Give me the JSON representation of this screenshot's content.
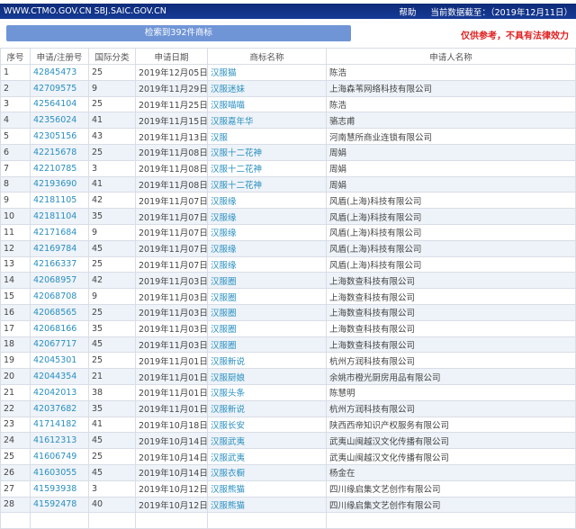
{
  "header": {
    "domains": "WWW.CTMO.GOV.CN SBJ.SAIC.GOV.CN",
    "help": "帮助",
    "data_date": "当前数据截至：（2019年12月11日）"
  },
  "search_result_label": "检索到392件商标",
  "disclaimer": "仅供参考，不具有法律效力",
  "columns": [
    "序号",
    "申请/注册号",
    "国际分类",
    "申请日期",
    "商标名称",
    "申请人名称"
  ],
  "rows": [
    [
      "1",
      "42845473",
      "25",
      "2019年12月05日",
      "汉服猫",
      "陈浩"
    ],
    [
      "2",
      "42709575",
      "9",
      "2019年11月29日",
      "汉服迷妹",
      "上海森苇网络科技有限公司"
    ],
    [
      "3",
      "42564104",
      "25",
      "2019年11月25日",
      "汉服喵喵",
      "陈浩"
    ],
    [
      "4",
      "42356024",
      "41",
      "2019年11月15日",
      "汉服嘉年华",
      "骆志甫"
    ],
    [
      "5",
      "42305156",
      "43",
      "2019年11月13日",
      "汉服",
      "河南慧所商业连锁有限公司"
    ],
    [
      "6",
      "42215678",
      "25",
      "2019年11月08日",
      "汉服十二花神",
      "周娟"
    ],
    [
      "7",
      "42210785",
      "3",
      "2019年11月08日",
      "汉服十二花神",
      "周娟"
    ],
    [
      "8",
      "42193690",
      "41",
      "2019年11月08日",
      "汉服十二花神",
      "周娟"
    ],
    [
      "9",
      "42181105",
      "42",
      "2019年11月07日",
      "汉服缘",
      "风盾(上海)科技有限公司"
    ],
    [
      "10",
      "42181104",
      "35",
      "2019年11月07日",
      "汉服缘",
      "风盾(上海)科技有限公司"
    ],
    [
      "11",
      "42171684",
      "9",
      "2019年11月07日",
      "汉服缘",
      "风盾(上海)科技有限公司"
    ],
    [
      "12",
      "42169784",
      "45",
      "2019年11月07日",
      "汉服缘",
      "风盾(上海)科技有限公司"
    ],
    [
      "13",
      "42166337",
      "25",
      "2019年11月07日",
      "汉服缘",
      "风盾(上海)科技有限公司"
    ],
    [
      "14",
      "42068957",
      "42",
      "2019年11月03日",
      "汉服圈",
      "上海数查科技有限公司"
    ],
    [
      "15",
      "42068708",
      "9",
      "2019年11月03日",
      "汉服圈",
      "上海数查科技有限公司"
    ],
    [
      "16",
      "42068565",
      "25",
      "2019年11月03日",
      "汉服圈",
      "上海数查科技有限公司"
    ],
    [
      "17",
      "42068166",
      "35",
      "2019年11月03日",
      "汉服圈",
      "上海数查科技有限公司"
    ],
    [
      "18",
      "42067717",
      "45",
      "2019年11月03日",
      "汉服圈",
      "上海数查科技有限公司"
    ],
    [
      "19",
      "42045301",
      "25",
      "2019年11月01日",
      "汉服新说",
      "杭州方润科技有限公司"
    ],
    [
      "20",
      "42044354",
      "21",
      "2019年11月01日",
      "汉服厨娘",
      "余姚市橙光厨房用品有限公司"
    ],
    [
      "21",
      "42042013",
      "38",
      "2019年11月01日",
      "汉服头条",
      "陈慧明"
    ],
    [
      "22",
      "42037682",
      "35",
      "2019年11月01日",
      "汉服新说",
      "杭州方润科技有限公司"
    ],
    [
      "23",
      "41714182",
      "41",
      "2019年10月18日",
      "汉服长安",
      "陕西西帝知识产权服务有限公司"
    ],
    [
      "24",
      "41612313",
      "45",
      "2019年10月14日",
      "汉服武夷",
      "武夷山闽越汉文化传播有限公司"
    ],
    [
      "25",
      "41606749",
      "25",
      "2019年10月14日",
      "汉服武夷",
      "武夷山闽越汉文化传播有限公司"
    ],
    [
      "26",
      "41603055",
      "45",
      "2019年10月14日",
      "汉服衣橱",
      "杨金在"
    ],
    [
      "27",
      "41593938",
      "3",
      "2019年10月12日",
      "汉服熊猫",
      "四川缘启集文艺创作有限公司"
    ],
    [
      "28",
      "41592478",
      "40",
      "2019年10月12日",
      "汉服熊猫",
      "四川缘启集文艺创作有限公司"
    ]
  ]
}
